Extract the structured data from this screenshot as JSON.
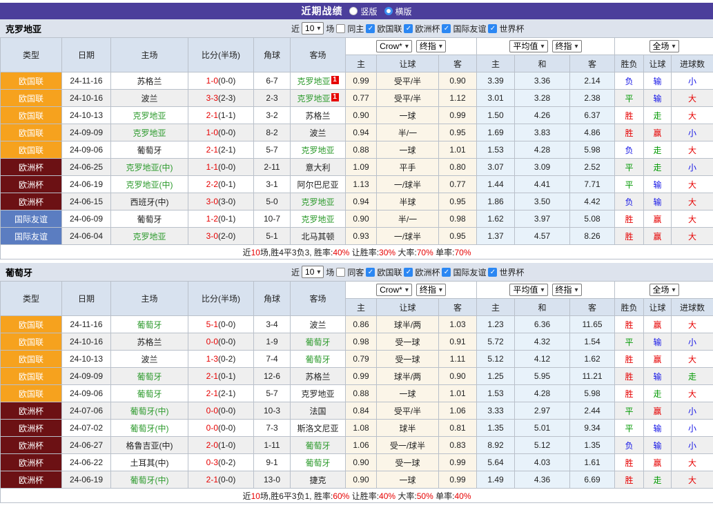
{
  "topbar": {
    "title": "近期战绩",
    "options": [
      {
        "label": "竖版",
        "selected": false
      },
      {
        "label": "横版",
        "selected": true
      }
    ]
  },
  "filters": {
    "near_label": "近",
    "matches_count": "10",
    "games_label": "场",
    "leagues": [
      "欧国联",
      "欧洲杯",
      "国际友谊",
      "世界杯"
    ]
  },
  "table_header": {
    "base_columns": [
      "类型",
      "日期",
      "主场",
      "比分(半场)",
      "角球",
      "客场"
    ],
    "odds_columns": [
      "主",
      "让球",
      "客",
      "主",
      "和",
      "客",
      "胜负",
      "让球",
      "进球数"
    ],
    "selects_group1": [
      "Crow*",
      "终指"
    ],
    "selects_group2": [
      "平均值",
      "终指"
    ],
    "selects_group3": [
      "全场"
    ]
  },
  "league_styles": {
    "欧国联": "#f6a21e",
    "欧洲杯": "#6c1114",
    "国际友谊": "#5b7dc1"
  },
  "colors": {
    "win_red": "#e60000",
    "draw_green": "#009900",
    "lose_blue": "#1414e6",
    "team_highlight_green": "#2c9a2c",
    "topbar_purple": "#4b3e9b",
    "badge_orange": "#f6a21e",
    "badge_maroon": "#6c1114",
    "badge_blue": "#5b7dc1"
  },
  "sections": [
    {
      "team": "克罗地亚",
      "same_side_label": "同主",
      "rows": [
        {
          "lg": "欧国联",
          "dt": "24-11-16",
          "hm": "苏格兰",
          "hm_hl": false,
          "hm_card": "",
          "sc": "1-0",
          "hf": "(0-0)",
          "cn": "6-7",
          "aw": "克罗地亚",
          "aw_hl": true,
          "aw_card": "1",
          "o1": "0.99",
          "hc": "受平/半",
          "o2": "0.90",
          "m1": "3.39",
          "m2": "3.36",
          "m3": "2.14",
          "r1": "负",
          "r1c": "b",
          "r2": "输",
          "r2c": "b",
          "r3": "小",
          "r3c": "b"
        },
        {
          "lg": "欧国联",
          "dt": "24-10-16",
          "hm": "波兰",
          "hm_hl": false,
          "hm_card": "",
          "sc": "3-3",
          "hf": "(2-3)",
          "cn": "2-3",
          "aw": "克罗地亚",
          "aw_hl": true,
          "aw_card": "1",
          "o1": "0.77",
          "hc": "受平/半",
          "o2": "1.12",
          "m1": "3.01",
          "m2": "3.28",
          "m3": "2.38",
          "r1": "平",
          "r1c": "g",
          "r2": "输",
          "r2c": "b",
          "r3": "大",
          "r3c": "r"
        },
        {
          "lg": "欧国联",
          "dt": "24-10-13",
          "hm": "克罗地亚",
          "hm_hl": true,
          "hm_card": "",
          "sc": "2-1",
          "hf": "(1-1)",
          "cn": "3-2",
          "aw": "苏格兰",
          "aw_hl": false,
          "aw_card": "",
          "o1": "0.90",
          "hc": "一球",
          "o2": "0.99",
          "m1": "1.50",
          "m2": "4.26",
          "m3": "6.37",
          "r1": "胜",
          "r1c": "r",
          "r2": "走",
          "r2c": "g",
          "r3": "大",
          "r3c": "r"
        },
        {
          "lg": "欧国联",
          "dt": "24-09-09",
          "hm": "克罗地亚",
          "hm_hl": true,
          "hm_card": "",
          "sc": "1-0",
          "hf": "(0-0)",
          "cn": "8-2",
          "aw": "波兰",
          "aw_hl": false,
          "aw_card": "",
          "o1": "0.94",
          "hc": "半/一",
          "o2": "0.95",
          "m1": "1.69",
          "m2": "3.83",
          "m3": "4.86",
          "r1": "胜",
          "r1c": "r",
          "r2": "赢",
          "r2c": "r",
          "r3": "小",
          "r3c": "b"
        },
        {
          "lg": "欧国联",
          "dt": "24-09-06",
          "hm": "葡萄牙",
          "hm_hl": false,
          "hm_card": "",
          "sc": "2-1",
          "hf": "(2-1)",
          "cn": "5-7",
          "aw": "克罗地亚",
          "aw_hl": true,
          "aw_card": "",
          "o1": "0.88",
          "hc": "一球",
          "o2": "1.01",
          "m1": "1.53",
          "m2": "4.28",
          "m3": "5.98",
          "r1": "负",
          "r1c": "b",
          "r2": "走",
          "r2c": "g",
          "r3": "大",
          "r3c": "r"
        },
        {
          "lg": "欧洲杯",
          "dt": "24-06-25",
          "hm": "克罗地亚(中)",
          "hm_hl": true,
          "hm_card": "",
          "sc": "1-1",
          "hf": "(0-0)",
          "cn": "2-11",
          "aw": "意大利",
          "aw_hl": false,
          "aw_card": "",
          "o1": "1.09",
          "hc": "平手",
          "o2": "0.80",
          "m1": "3.07",
          "m2": "3.09",
          "m3": "2.52",
          "r1": "平",
          "r1c": "g",
          "r2": "走",
          "r2c": "g",
          "r3": "小",
          "r3c": "b"
        },
        {
          "lg": "欧洲杯",
          "dt": "24-06-19",
          "hm": "克罗地亚(中)",
          "hm_hl": true,
          "hm_card": "",
          "sc": "2-2",
          "hf": "(0-1)",
          "cn": "3-1",
          "aw": "阿尔巴尼亚",
          "aw_hl": false,
          "aw_card": "",
          "o1": "1.13",
          "hc": "一/球半",
          "o2": "0.77",
          "m1": "1.44",
          "m2": "4.41",
          "m3": "7.71",
          "r1": "平",
          "r1c": "g",
          "r2": "输",
          "r2c": "b",
          "r3": "大",
          "r3c": "r"
        },
        {
          "lg": "欧洲杯",
          "dt": "24-06-15",
          "hm": "西班牙(中)",
          "hm_hl": false,
          "hm_card": "",
          "sc": "3-0",
          "hf": "(3-0)",
          "cn": "5-0",
          "aw": "克罗地亚",
          "aw_hl": true,
          "aw_card": "",
          "o1": "0.94",
          "hc": "半球",
          "o2": "0.95",
          "m1": "1.86",
          "m2": "3.50",
          "m3": "4.42",
          "r1": "负",
          "r1c": "b",
          "r2": "输",
          "r2c": "b",
          "r3": "大",
          "r3c": "r"
        },
        {
          "lg": "国际友谊",
          "dt": "24-06-09",
          "hm": "葡萄牙",
          "hm_hl": false,
          "hm_card": "",
          "sc": "1-2",
          "hf": "(0-1)",
          "cn": "10-7",
          "aw": "克罗地亚",
          "aw_hl": true,
          "aw_card": "",
          "o1": "0.90",
          "hc": "半/一",
          "o2": "0.98",
          "m1": "1.62",
          "m2": "3.97",
          "m3": "5.08",
          "r1": "胜",
          "r1c": "r",
          "r2": "赢",
          "r2c": "r",
          "r3": "大",
          "r3c": "r"
        },
        {
          "lg": "国际友谊",
          "dt": "24-06-04",
          "hm": "克罗地亚",
          "hm_hl": true,
          "hm_card": "",
          "sc": "3-0",
          "hf": "(2-0)",
          "cn": "5-1",
          "aw": "北马其顿",
          "aw_hl": false,
          "aw_card": "",
          "o1": "0.93",
          "hc": "一/球半",
          "o2": "0.95",
          "m1": "1.37",
          "m2": "4.57",
          "m3": "8.26",
          "r1": "胜",
          "r1c": "r",
          "r2": "赢",
          "r2c": "r",
          "r3": "大",
          "r3c": "r"
        }
      ],
      "summary": {
        "prefix": "近",
        "count": "10",
        "record": "场,胜4平3负3,",
        "rates": [
          {
            "label": "胜率:",
            "value": "40%"
          },
          {
            "label": "让胜率:",
            "value": "30%"
          },
          {
            "label": "大率:",
            "value": "70%"
          },
          {
            "label": "单率:",
            "value": "70%"
          }
        ]
      }
    },
    {
      "team": "葡萄牙",
      "same_side_label": "同客",
      "rows": [
        {
          "lg": "欧国联",
          "dt": "24-11-16",
          "hm": "葡萄牙",
          "hm_hl": true,
          "hm_card": "",
          "sc": "5-1",
          "hf": "(0-0)",
          "cn": "3-4",
          "aw": "波兰",
          "aw_hl": false,
          "aw_card": "",
          "o1": "0.86",
          "hc": "球半/两",
          "o2": "1.03",
          "m1": "1.23",
          "m2": "6.36",
          "m3": "11.65",
          "r1": "胜",
          "r1c": "r",
          "r2": "赢",
          "r2c": "r",
          "r3": "大",
          "r3c": "r"
        },
        {
          "lg": "欧国联",
          "dt": "24-10-16",
          "hm": "苏格兰",
          "hm_hl": false,
          "hm_card": "",
          "sc": "0-0",
          "hf": "(0-0)",
          "cn": "1-9",
          "aw": "葡萄牙",
          "aw_hl": true,
          "aw_card": "",
          "o1": "0.98",
          "hc": "受一球",
          "o2": "0.91",
          "m1": "5.72",
          "m2": "4.32",
          "m3": "1.54",
          "r1": "平",
          "r1c": "g",
          "r2": "输",
          "r2c": "b",
          "r3": "小",
          "r3c": "b"
        },
        {
          "lg": "欧国联",
          "dt": "24-10-13",
          "hm": "波兰",
          "hm_hl": false,
          "hm_card": "",
          "sc": "1-3",
          "hf": "(0-2)",
          "cn": "7-4",
          "aw": "葡萄牙",
          "aw_hl": true,
          "aw_card": "",
          "o1": "0.79",
          "hc": "受一球",
          "o2": "1.11",
          "m1": "5.12",
          "m2": "4.12",
          "m3": "1.62",
          "r1": "胜",
          "r1c": "r",
          "r2": "赢",
          "r2c": "r",
          "r3": "大",
          "r3c": "r"
        },
        {
          "lg": "欧国联",
          "dt": "24-09-09",
          "hm": "葡萄牙",
          "hm_hl": true,
          "hm_card": "",
          "sc": "2-1",
          "hf": "(0-1)",
          "cn": "12-6",
          "aw": "苏格兰",
          "aw_hl": false,
          "aw_card": "",
          "o1": "0.99",
          "hc": "球半/两",
          "o2": "0.90",
          "m1": "1.25",
          "m2": "5.95",
          "m3": "11.21",
          "r1": "胜",
          "r1c": "r",
          "r2": "输",
          "r2c": "b",
          "r3": "走",
          "r3c": "g"
        },
        {
          "lg": "欧国联",
          "dt": "24-09-06",
          "hm": "葡萄牙",
          "hm_hl": true,
          "hm_card": "",
          "sc": "2-1",
          "hf": "(2-1)",
          "cn": "5-7",
          "aw": "克罗地亚",
          "aw_hl": false,
          "aw_card": "",
          "o1": "0.88",
          "hc": "一球",
          "o2": "1.01",
          "m1": "1.53",
          "m2": "4.28",
          "m3": "5.98",
          "r1": "胜",
          "r1c": "r",
          "r2": "走",
          "r2c": "g",
          "r3": "大",
          "r3c": "r"
        },
        {
          "lg": "欧洲杯",
          "dt": "24-07-06",
          "hm": "葡萄牙(中)",
          "hm_hl": true,
          "hm_card": "",
          "sc": "0-0",
          "hf": "(0-0)",
          "cn": "10-3",
          "aw": "法国",
          "aw_hl": false,
          "aw_card": "",
          "o1": "0.84",
          "hc": "受平/半",
          "o2": "1.06",
          "m1": "3.33",
          "m2": "2.97",
          "m3": "2.44",
          "r1": "平",
          "r1c": "g",
          "r2": "赢",
          "r2c": "r",
          "r3": "小",
          "r3c": "b"
        },
        {
          "lg": "欧洲杯",
          "dt": "24-07-02",
          "hm": "葡萄牙(中)",
          "hm_hl": true,
          "hm_card": "",
          "sc": "0-0",
          "hf": "(0-0)",
          "cn": "7-3",
          "aw": "斯洛文尼亚",
          "aw_hl": false,
          "aw_card": "",
          "o1": "1.08",
          "hc": "球半",
          "o2": "0.81",
          "m1": "1.35",
          "m2": "5.01",
          "m3": "9.34",
          "r1": "平",
          "r1c": "g",
          "r2": "输",
          "r2c": "b",
          "r3": "小",
          "r3c": "b"
        },
        {
          "lg": "欧洲杯",
          "dt": "24-06-27",
          "hm": "格鲁吉亚(中)",
          "hm_hl": false,
          "hm_card": "",
          "sc": "2-0",
          "hf": "(1-0)",
          "cn": "1-11",
          "aw": "葡萄牙",
          "aw_hl": true,
          "aw_card": "",
          "o1": "1.06",
          "hc": "受一/球半",
          "o2": "0.83",
          "m1": "8.92",
          "m2": "5.12",
          "m3": "1.35",
          "r1": "负",
          "r1c": "b",
          "r2": "输",
          "r2c": "b",
          "r3": "小",
          "r3c": "b"
        },
        {
          "lg": "欧洲杯",
          "dt": "24-06-22",
          "hm": "土耳其(中)",
          "hm_hl": false,
          "hm_card": "",
          "sc": "0-3",
          "hf": "(0-2)",
          "cn": "9-1",
          "aw": "葡萄牙",
          "aw_hl": true,
          "aw_card": "",
          "o1": "0.90",
          "hc": "受一球",
          "o2": "0.99",
          "m1": "5.64",
          "m2": "4.03",
          "m3": "1.61",
          "r1": "胜",
          "r1c": "r",
          "r2": "赢",
          "r2c": "r",
          "r3": "大",
          "r3c": "r"
        },
        {
          "lg": "欧洲杯",
          "dt": "24-06-19",
          "hm": "葡萄牙(中)",
          "hm_hl": true,
          "hm_card": "",
          "sc": "2-1",
          "hf": "(0-0)",
          "cn": "13-0",
          "aw": "捷克",
          "aw_hl": false,
          "aw_card": "",
          "o1": "0.90",
          "hc": "一球",
          "o2": "0.99",
          "m1": "1.49",
          "m2": "4.36",
          "m3": "6.69",
          "r1": "胜",
          "r1c": "r",
          "r2": "走",
          "r2c": "g",
          "r3": "大",
          "r3c": "r"
        }
      ],
      "summary": {
        "prefix": "近",
        "count": "10",
        "record": "场,胜6平3负1,",
        "rates": [
          {
            "label": "胜率:",
            "value": "60%"
          },
          {
            "label": "让胜率:",
            "value": "40%"
          },
          {
            "label": "大率:",
            "value": "50%"
          },
          {
            "label": "单率:",
            "value": "40%"
          }
        ]
      }
    }
  ]
}
